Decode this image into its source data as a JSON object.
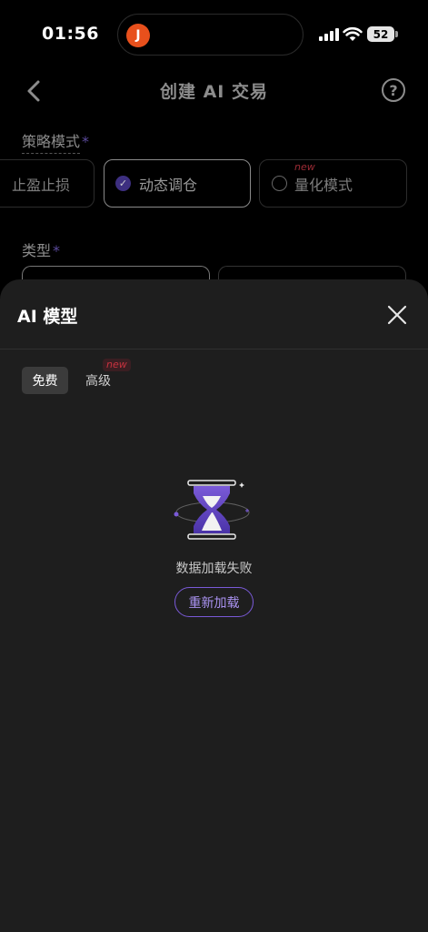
{
  "status_bar": {
    "time": "01:56",
    "battery": "52",
    "app_logo_glyph": "J"
  },
  "header": {
    "title": "创建 AI 交易",
    "help_icon": "?"
  },
  "form": {
    "strategy_label": "策略模式",
    "required_mark": "*",
    "strategy_options": [
      {
        "label": "止盈止损",
        "state": "partial"
      },
      {
        "label": "动态调仓",
        "state": "selected"
      },
      {
        "label": "量化模式",
        "state": "unselected",
        "badge": "new"
      }
    ],
    "type_label": "类型"
  },
  "sheet": {
    "title": "AI 模型",
    "tabs": [
      {
        "label": "免费",
        "active": true
      },
      {
        "label": "高级",
        "active": false,
        "badge": "new"
      }
    ],
    "empty_message": "数据加载失败",
    "reload_label": "重新加载"
  },
  "colors": {
    "accent": "#7a5ad8",
    "new_badge": "#c8323f",
    "sheet_bg": "#1e1e1e"
  }
}
